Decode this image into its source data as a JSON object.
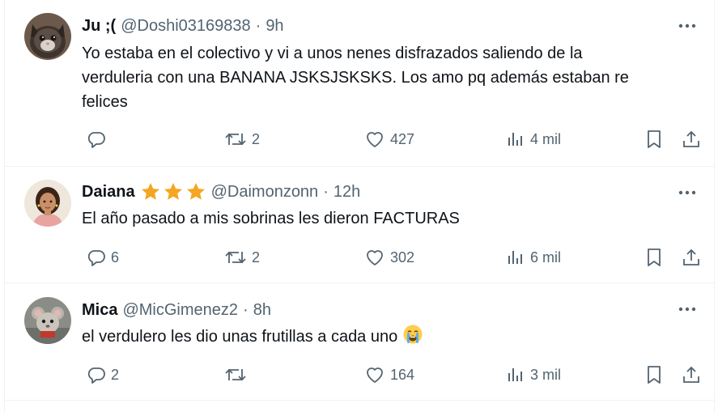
{
  "tweets": [
    {
      "name": "Ju ;(",
      "handle": "@Doshi03169838",
      "separator": "·",
      "time": "9h",
      "text_lines": [
        "Yo estaba en el colectivo y vi a unos nenes disfrazados saliendo de la",
        "verduleria con una BANANA JSKSJSKSKS. Los amo pq además estaban re",
        "felices"
      ],
      "replies": "",
      "reposts": "2",
      "likes": "427",
      "views": "4 mil"
    },
    {
      "name": "Daiana",
      "stars": "⭐⭐⭐",
      "handle": "@Daimonzonn",
      "separator": "·",
      "time": "12h",
      "text_lines": [
        "El año pasado a mis sobrinas les dieron FACTURAS"
      ],
      "replies": "6",
      "reposts": "2",
      "likes": "302",
      "views": "6 mil"
    },
    {
      "name": "Mica",
      "handle": "@MicGimenez2",
      "separator": "·",
      "time": "8h",
      "text_lines": [
        "el verdulero les dio unas frutillas a cada uno"
      ],
      "emoji": "crying-face-emoji",
      "replies": "2",
      "reposts": "",
      "likes": "164",
      "views": "3 mil"
    }
  ],
  "icons": {
    "reply": "reply-icon",
    "repost": "repost-icon",
    "like": "like-icon",
    "views": "views-icon",
    "bookmark": "bookmark-icon",
    "share": "share-icon",
    "more": "more-icon"
  },
  "colors": {
    "text": "#0f1419",
    "secondary": "#536471",
    "divider": "#eff3f4",
    "star": "#f4a623"
  }
}
